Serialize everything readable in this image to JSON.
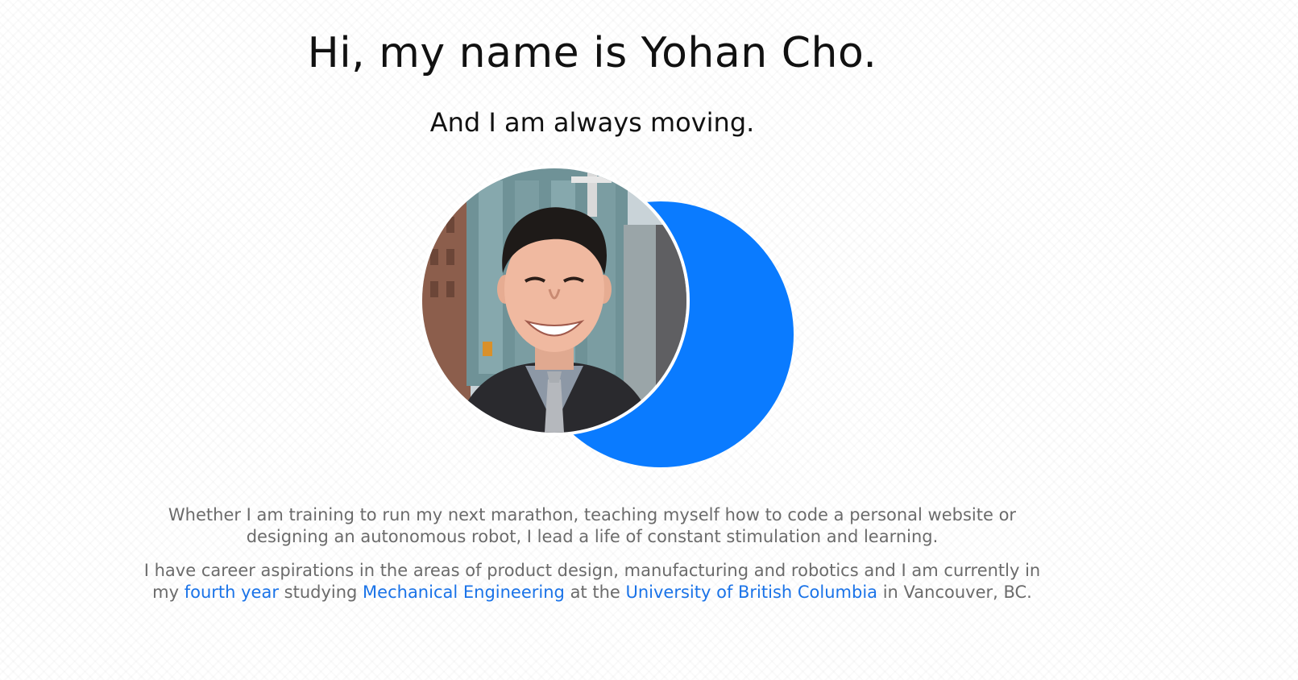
{
  "hero": {
    "title": "Hi, my name is Yohan Cho.",
    "subtitle": "And I am always moving."
  },
  "bio": {
    "paragraph1": {
      "line1": "Whether I am training to run my next marathon, teaching myself how to code a personal website or",
      "line2": "designing an autonomous robot, I lead a life of constant stimulation and learning."
    },
    "paragraph2": {
      "line1": "I have career aspirations in the areas of product design, manufacturing and robotics and I am currently in",
      "prefix": "my ",
      "link_year": "fourth year",
      "text_studying": " studying ",
      "link_program": "Mechanical Engineering",
      "text_at": " at the ",
      "link_university": "University of British Columbia",
      "suffix": " in Vancouver, BC."
    }
  },
  "colors": {
    "accent": "#0a7bff",
    "link": "#1a73e8",
    "heading": "#111111",
    "body_text": "#6b6b6b"
  },
  "images": {
    "portrait": "portrait-photo",
    "decoration": "blue-crescent"
  }
}
